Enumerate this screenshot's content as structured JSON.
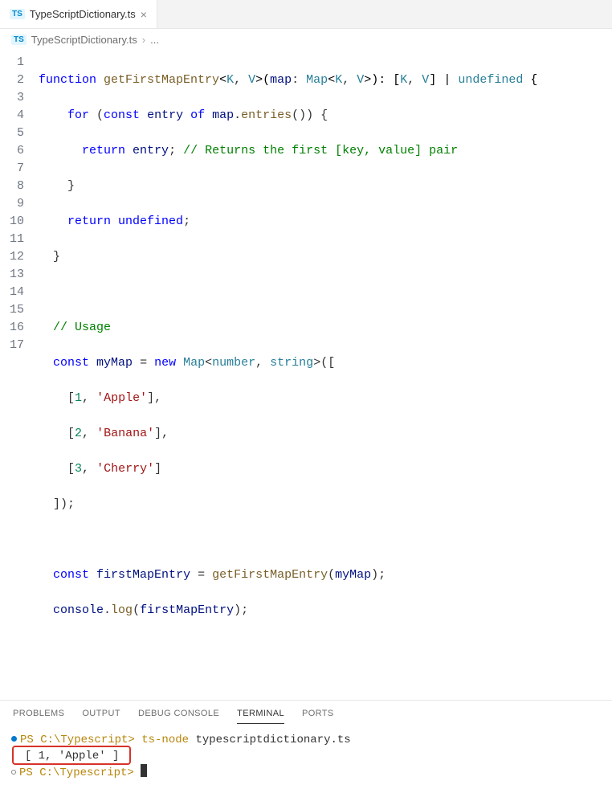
{
  "tab": {
    "icon": "TS",
    "filename": "TypeScriptDictionary.ts"
  },
  "breadcrumb": {
    "icon": "TS",
    "filename": "TypeScriptDictionary.ts",
    "sep": "›",
    "more": "..."
  },
  "lines": [
    "1",
    "2",
    "3",
    "4",
    "5",
    "6",
    "7",
    "8",
    "9",
    "10",
    "11",
    "12",
    "13",
    "14",
    "15",
    "16",
    "17"
  ],
  "code": {
    "l1": {
      "kw1": "function",
      "fn": "getFirstMapEntry",
      "lt": "<",
      "tp1": "K",
      "c1": ", ",
      "tp2": "V",
      "gt": ">(",
      "var": "map",
      "col": ": ",
      "tp3": "Map",
      "lt2": "<",
      "tp4": "K",
      "c2": ", ",
      "tp5": "V",
      "gt2": ">): [",
      "tp6": "K",
      "c3": ", ",
      "tp7": "V",
      "br": "] | ",
      "tp8": "undefined",
      "ob": " {"
    },
    "l2": {
      "kw1": "for",
      "p1": " (",
      "kw2": "const",
      "sp": " ",
      "var": "entry",
      "kw3": " of ",
      "var2": "map",
      "dot": ".",
      "fn": "entries",
      "p2": "()) {"
    },
    "l3": {
      "kw": "return",
      "sp": " ",
      "var": "entry",
      "sc": "; ",
      "cm": "// Returns the first [key, value] pair"
    },
    "l4": {
      "cb": "}"
    },
    "l5": {
      "kw": "return",
      "sp": " ",
      "val": "undefined",
      "sc": ";"
    },
    "l6": {
      "cb": "}"
    },
    "l8": {
      "cm": "// Usage"
    },
    "l9": {
      "kw1": "const",
      "sp": " ",
      "var": "myMap",
      "eq": " = ",
      "kw2": "new",
      "sp2": " ",
      "tp": "Map",
      "lt": "<",
      "tp2": "number",
      "c": ", ",
      "tp3": "string",
      "gt": ">(["
    },
    "l10": {
      "ob": "[",
      "n": "1",
      "c": ", ",
      "s": "'Apple'",
      "cb": "],"
    },
    "l11": {
      "ob": "[",
      "n": "2",
      "c": ", ",
      "s": "'Banana'",
      "cb": "],"
    },
    "l12": {
      "ob": "[",
      "n": "3",
      "c": ", ",
      "s": "'Cherry'",
      "cb": "]"
    },
    "l13": {
      "cb": "]);"
    },
    "l15": {
      "kw": "const",
      "sp": " ",
      "var": "firstMapEntry",
      "eq": " = ",
      "fn": "getFirstMapEntry",
      "p1": "(",
      "var2": "myMap",
      "p2": ");"
    },
    "l16": {
      "var": "console",
      "dot": ".",
      "fn": "log",
      "p1": "(",
      "var2": "firstMapEntry",
      "p2": ");"
    }
  },
  "panel": {
    "tabs": {
      "problems": "PROBLEMS",
      "output": "OUTPUT",
      "debug": "DEBUG CONSOLE",
      "terminal": "TERMINAL",
      "ports": "PORTS"
    }
  },
  "terminal": {
    "line1": {
      "prompt": "PS C:\\Typescript>",
      "cmd": " ts-node",
      "arg": " typescriptdictionary.ts"
    },
    "line2": "[ 1, 'Apple' ]",
    "line3": {
      "prompt": "PS C:\\Typescript>"
    }
  }
}
